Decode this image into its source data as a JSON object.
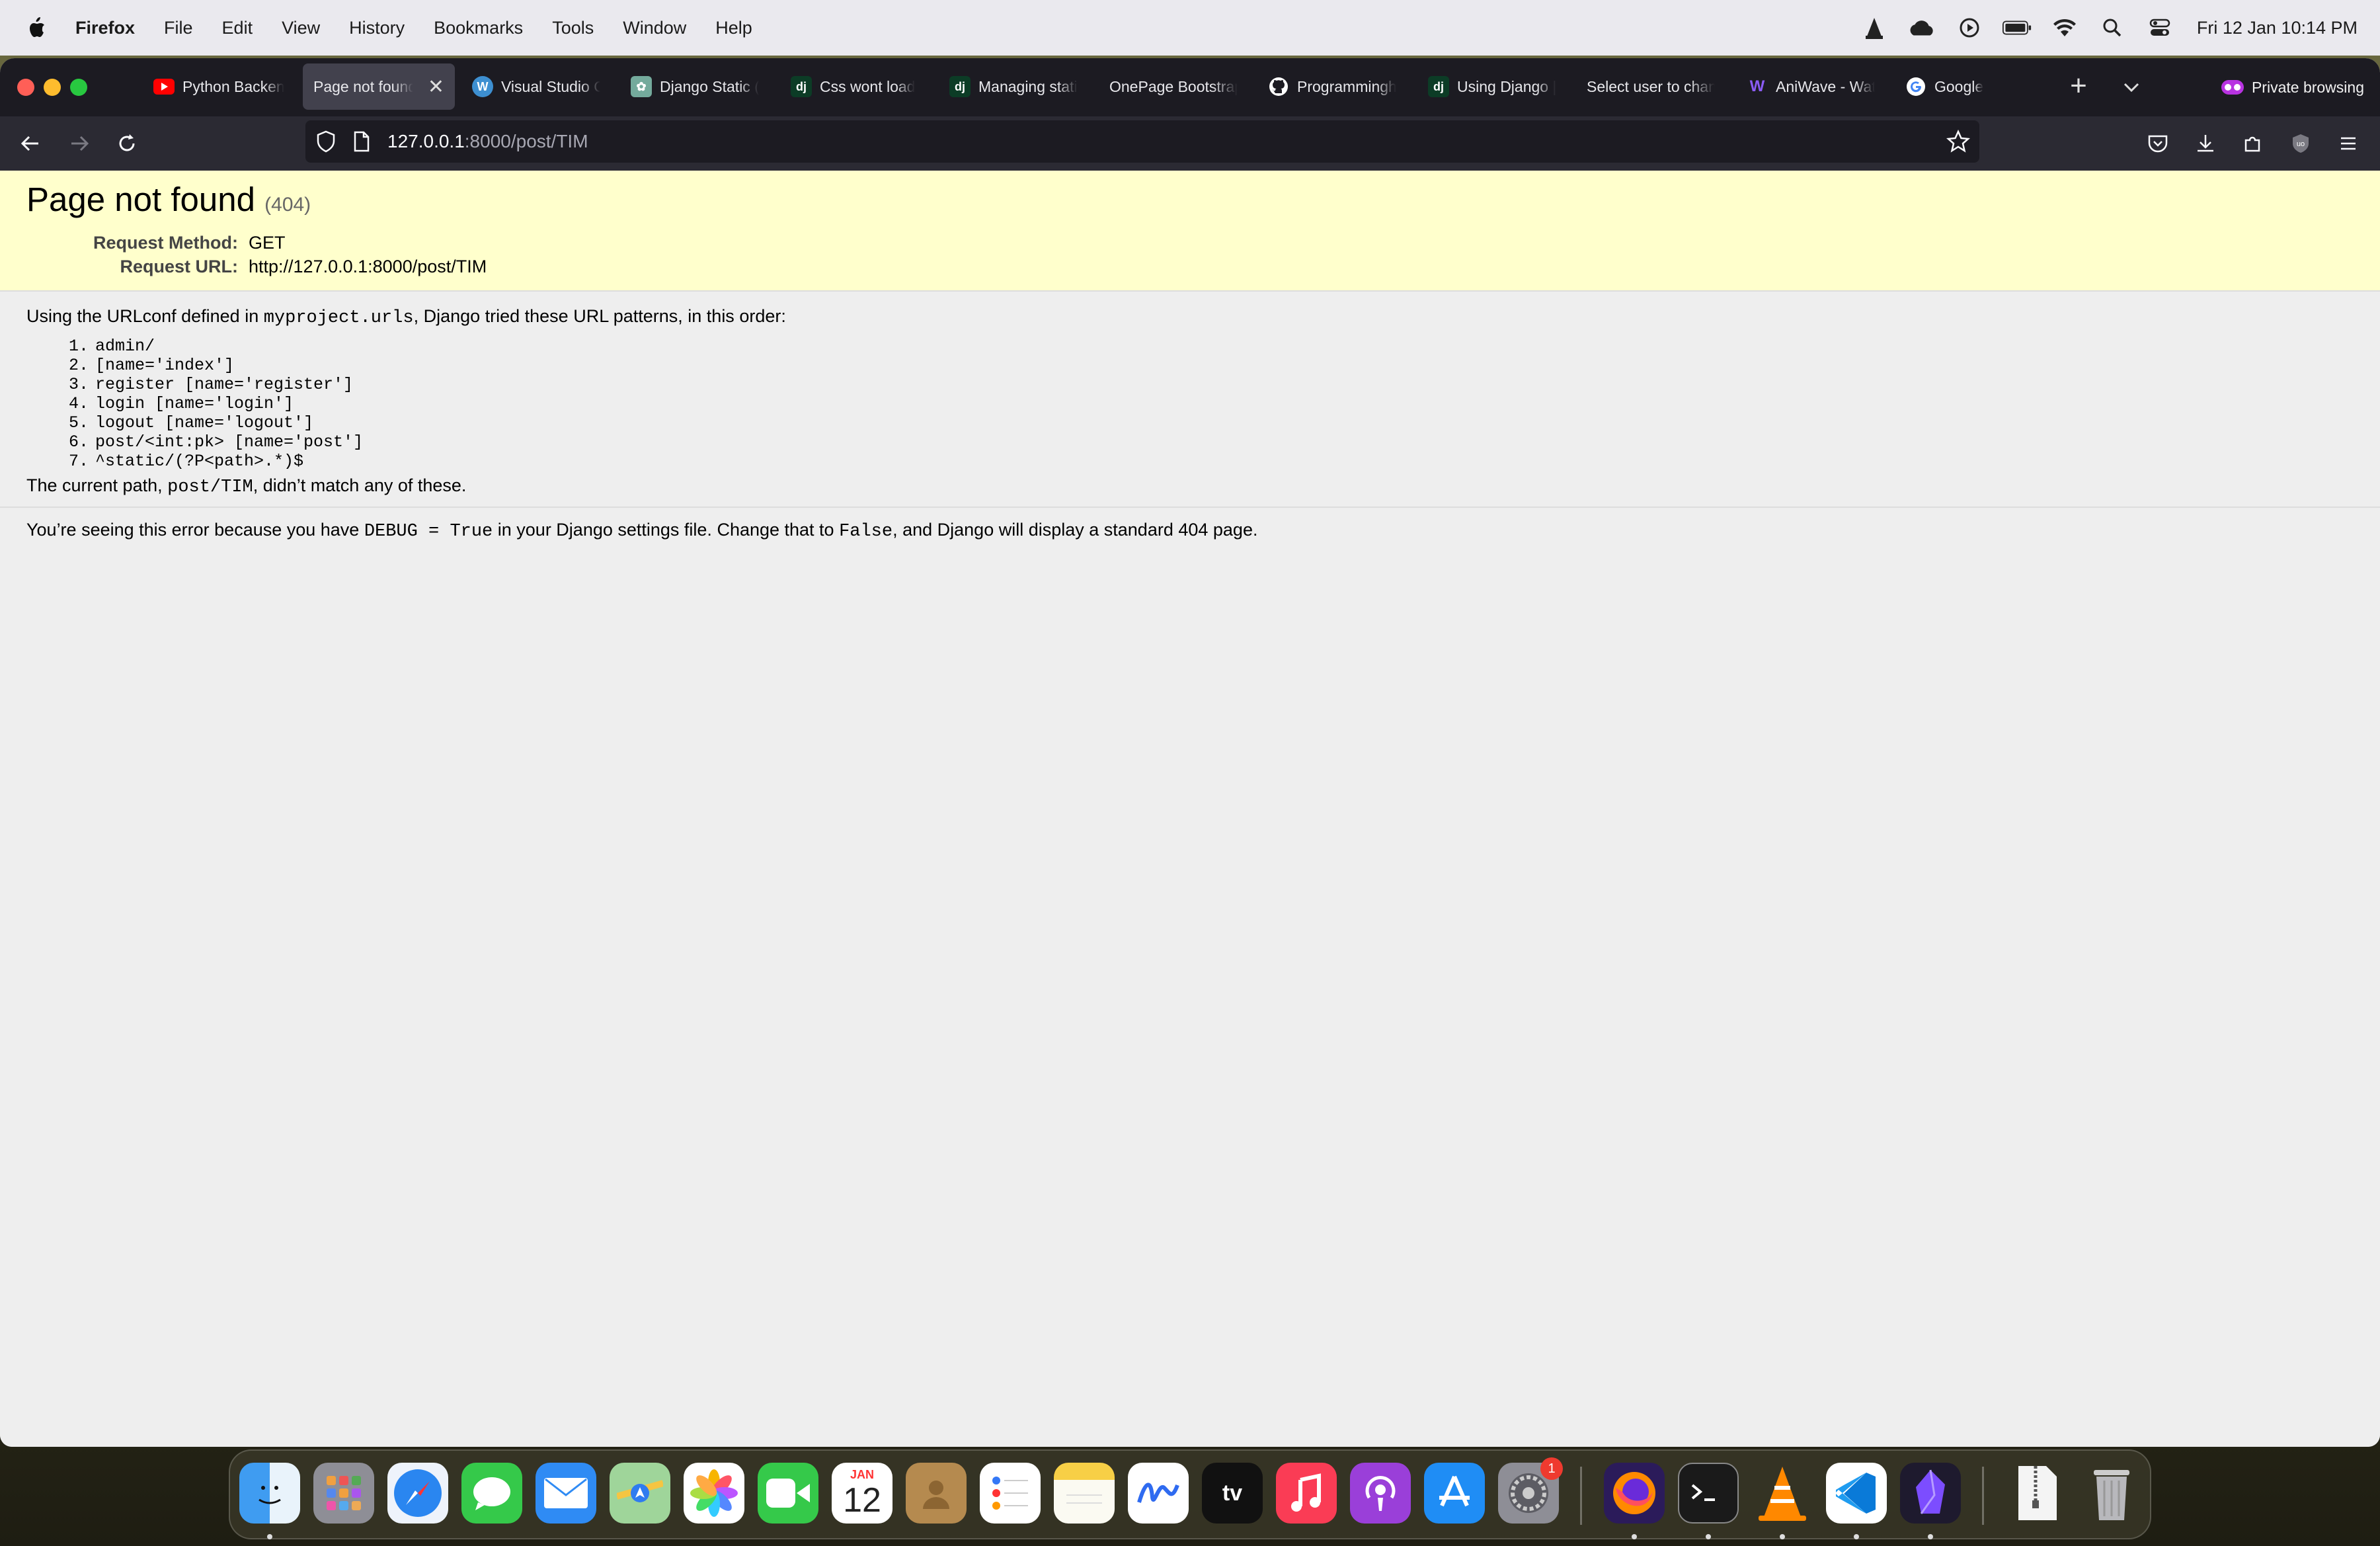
{
  "menubar": {
    "app_name": "Firefox",
    "items": [
      "File",
      "Edit",
      "View",
      "History",
      "Bookmarks",
      "Tools",
      "Window",
      "Help"
    ],
    "clock": "Fri 12 Jan  10:14 PM"
  },
  "tabs": [
    {
      "label": "Python Backen",
      "icon": "youtube-icon"
    },
    {
      "label": "Page not found",
      "icon": "none",
      "active": true
    },
    {
      "label": "Visual Studio C",
      "icon": "wordpress-icon"
    },
    {
      "label": "Django Static (",
      "icon": "chatgpt-icon"
    },
    {
      "label": "Css wont load",
      "icon": "django-icon"
    },
    {
      "label": "Managing stati",
      "icon": "django-icon"
    },
    {
      "label": "OnePage Bootstrap",
      "icon": "none"
    },
    {
      "label": "Programmingh",
      "icon": "github-icon"
    },
    {
      "label": "Using Django |",
      "icon": "django-icon"
    },
    {
      "label": "Select user to chan",
      "icon": "none"
    },
    {
      "label": "AniWave - Wat",
      "icon": "aniwave-icon"
    },
    {
      "label": "Google",
      "icon": "google-icon"
    }
  ],
  "private_label": "Private browsing",
  "url": {
    "host": "127.0.0.1",
    "rest": ":8000/post/TIM"
  },
  "page": {
    "title": "Page not found",
    "code": "(404)",
    "request_method_label": "Request Method:",
    "request_method": "GET",
    "request_url_label": "Request URL:",
    "request_url": "http://127.0.0.1:8000/post/TIM",
    "intro_a": "Using the URLconf defined in ",
    "intro_code": "myproject.urls",
    "intro_b": ", Django tried these URL patterns, in this order:",
    "patterns": [
      "admin/",
      "[name='index']",
      "register [name='register']",
      "login [name='login']",
      "logout [name='logout']",
      "post/<int:pk> [name='post']",
      "^static/(?P<path>.*)$"
    ],
    "current_a": "The current path, ",
    "current_code": "post/TIM",
    "current_b": ", didn’t match any of these.",
    "debug_a": "You’re seeing this error because you have ",
    "debug_code1": "DEBUG = True",
    "debug_b": " in your Django settings file. Change that to ",
    "debug_code2": "False",
    "debug_c": ", and Django will display a standard 404 page."
  },
  "dock": {
    "calendar_month": "JAN",
    "calendar_day": "12",
    "settings_badge": "1",
    "apps": [
      "finder-icon",
      "launchpad-icon",
      "safari-icon",
      "messages-icon",
      "mail-icon",
      "maps-icon",
      "photos-icon",
      "facetime-icon",
      "calendar-icon",
      "contacts-icon",
      "reminders-icon",
      "notes-icon",
      "freeform-icon",
      "appletv-icon",
      "music-icon",
      "podcasts-icon",
      "appstore-icon",
      "system-settings-icon",
      "firefox-icon",
      "terminal-icon",
      "vlc-icon",
      "vscode-icon",
      "obsidian-icon",
      "archive-icon",
      "trash-icon"
    ]
  }
}
